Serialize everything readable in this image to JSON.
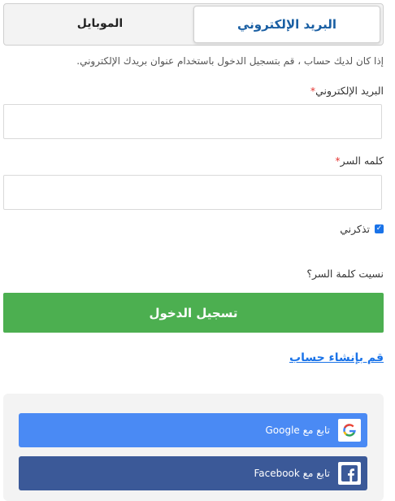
{
  "tabs": {
    "email_label": "البريد الإلكتروني",
    "mobile_label": "الموبايل"
  },
  "form": {
    "note": "إذا كان لديك حساب ، قم بتسجيل الدخول باستخدام عنوان بريدك الإلكتروني.",
    "email_label": "البريد الإلكتروني",
    "password_label": "كلمه السر",
    "required_mark": "*",
    "email_value": "",
    "password_value": "",
    "remember_label": "تذكرني",
    "remember_checked": true,
    "forgot_label": "نسيت كلمة السر؟",
    "login_label": "تسجيل الدخول",
    "signup_label": "قم بإنشاء حساب"
  },
  "social": {
    "google_label": "تابع مع Google",
    "facebook_label": "تابع مع Facebook"
  },
  "colors": {
    "accent_blue": "#1a73e8",
    "login_green": "#4caf50",
    "google_blue": "#4a8af4",
    "facebook_blue": "#3b5998"
  }
}
